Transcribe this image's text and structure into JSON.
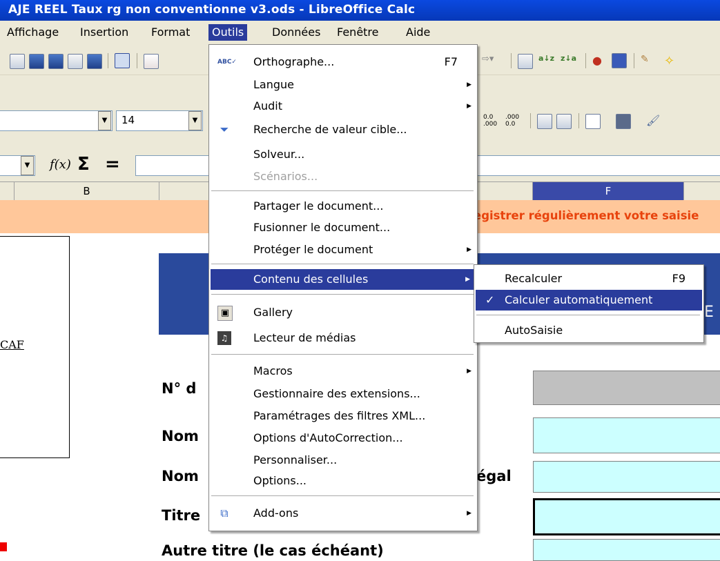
{
  "window": {
    "title": "AJE REEL Taux rg non conventionne v3.ods - LibreOffice Calc"
  },
  "menubar": [
    {
      "label": "Affichage",
      "name": "menu-affichage"
    },
    {
      "label": "Insertion",
      "name": "menu-insertion"
    },
    {
      "label": "Format",
      "name": "menu-format"
    },
    {
      "label": "Outils",
      "name": "menu-outils"
    },
    {
      "label": "Données",
      "name": "menu-donnees"
    },
    {
      "label": "Fenêtre",
      "name": "menu-fenetre"
    },
    {
      "label": "Aide",
      "name": "menu-aide"
    }
  ],
  "toolbar": {
    "font_size": "14",
    "name_box": ""
  },
  "formula_bar": {
    "function_wizard": "f(x)",
    "sum": "Σ",
    "equals": "=",
    "value": ""
  },
  "columns": {
    "b": "B",
    "f": "F"
  },
  "sheet": {
    "banner": "egistrer régulièrement votre saisie",
    "caf_text": "CAF",
    "rows": [
      {
        "label": "N° d"
      },
      {
        "label": "Nom"
      },
      {
        "label": "Nom",
        "suffix": "égal"
      },
      {
        "label": "Titre"
      },
      {
        "label": "Autre titre (le cas échéant)"
      }
    ],
    "right_edge_letter": "E"
  },
  "outils_menu": {
    "items": [
      {
        "label": "Orthographe...",
        "shortcut": "F7",
        "icon": "spellcheck-icon"
      },
      {
        "label": "Langue",
        "submenu": true
      },
      {
        "label": "Audit",
        "submenu": true
      },
      {
        "label": "Recherche de valeur cible...",
        "icon": "goal-seek-icon"
      },
      {
        "label": "Solveur..."
      },
      {
        "label": "Scénarios...",
        "disabled": true
      },
      {
        "label": "Partager le document..."
      },
      {
        "label": "Fusionner le document..."
      },
      {
        "label": "Protéger le document",
        "submenu": true
      },
      {
        "label": "Contenu des cellules",
        "submenu": true,
        "highlighted": true
      },
      {
        "label": "Gallery",
        "icon": "gallery-icon"
      },
      {
        "label": "Lecteur de médias",
        "icon": "media-player-icon"
      },
      {
        "label": "Macros",
        "submenu": true
      },
      {
        "label": "Gestionnaire des extensions..."
      },
      {
        "label": "Paramétrages des filtres XML..."
      },
      {
        "label": "Options d'AutoCorrection..."
      },
      {
        "label": "Personnaliser..."
      },
      {
        "label": "Options..."
      },
      {
        "label": "Add-ons",
        "submenu": true,
        "icon": "addons-icon"
      }
    ]
  },
  "contenu_submenu": {
    "items": [
      {
        "label": "Recalculer",
        "shortcut": "F9"
      },
      {
        "label": "Calculer automatiquement",
        "checked": true,
        "highlighted": true
      },
      {
        "label": "AutoSaisie"
      }
    ]
  }
}
